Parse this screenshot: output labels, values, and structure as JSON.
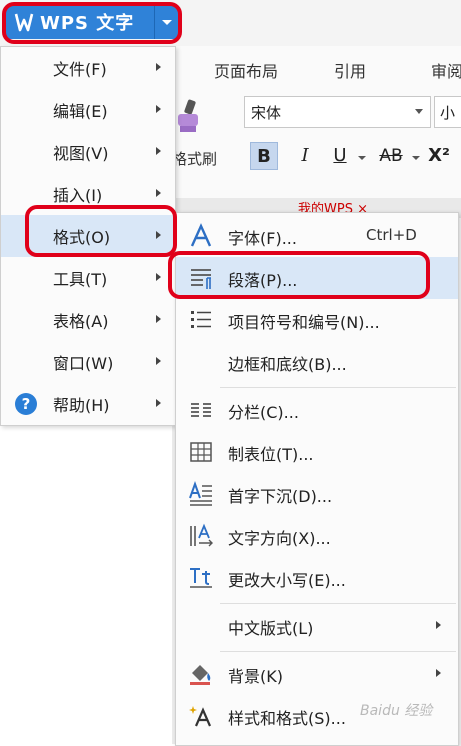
{
  "app": {
    "title": "WPS 文字"
  },
  "ribbon": {
    "tabs": [
      "页面布局",
      "引用",
      "审阅"
    ],
    "format_painter_label": "格式刷",
    "font_name": "宋体",
    "font_size": "小",
    "buttons": {
      "bold": "B",
      "italic": "I",
      "underline": "U",
      "strikethrough": "AB",
      "superscript": "X²"
    }
  },
  "doc_tab": {
    "label": "我的WPS ×"
  },
  "main_menu": {
    "items": [
      {
        "label": "文件(F)",
        "submenu": true
      },
      {
        "label": "编辑(E)",
        "submenu": true
      },
      {
        "label": "视图(V)",
        "submenu": true
      },
      {
        "label": "插入(I)",
        "submenu": true
      },
      {
        "label": "格式(O)",
        "submenu": true,
        "selected": true
      },
      {
        "label": "工具(T)",
        "submenu": true
      },
      {
        "label": "表格(A)",
        "submenu": true
      },
      {
        "label": "窗口(W)",
        "submenu": true
      },
      {
        "label": "帮助(H)",
        "submenu": true,
        "icon": "help-icon"
      }
    ],
    "help_icon_glyph": "?"
  },
  "format_submenu": {
    "items": [
      {
        "label": "字体(F)...",
        "shortcut": "Ctrl+D",
        "icon": "font-icon"
      },
      {
        "label": "段落(P)...",
        "icon": "paragraph-icon",
        "highlighted": true
      },
      {
        "label": "项目符号和编号(N)...",
        "icon": "bullet-list-icon"
      },
      {
        "label": "边框和底纹(B)..."
      },
      {
        "label": "分栏(C)...",
        "icon": "columns-icon"
      },
      {
        "label": "制表位(T)...",
        "icon": "tab-stops-icon"
      },
      {
        "label": "首字下沉(D)...",
        "icon": "drop-cap-icon"
      },
      {
        "label": "文字方向(X)...",
        "icon": "text-direction-icon"
      },
      {
        "label": "更改大小写(E)...",
        "icon": "change-case-icon"
      },
      {
        "label": "中文版式(L)",
        "submenu": true
      },
      {
        "label": "背景(K)",
        "submenu": true,
        "icon": "background-icon"
      },
      {
        "label": "样式和格式(S)...",
        "icon": "styles-icon"
      }
    ]
  },
  "colors": {
    "wps_blue": "#2f82d8",
    "menu_highlight": "#d9e7f7",
    "annotation_red": "#e0001a"
  },
  "watermark": "Baidu 经验"
}
